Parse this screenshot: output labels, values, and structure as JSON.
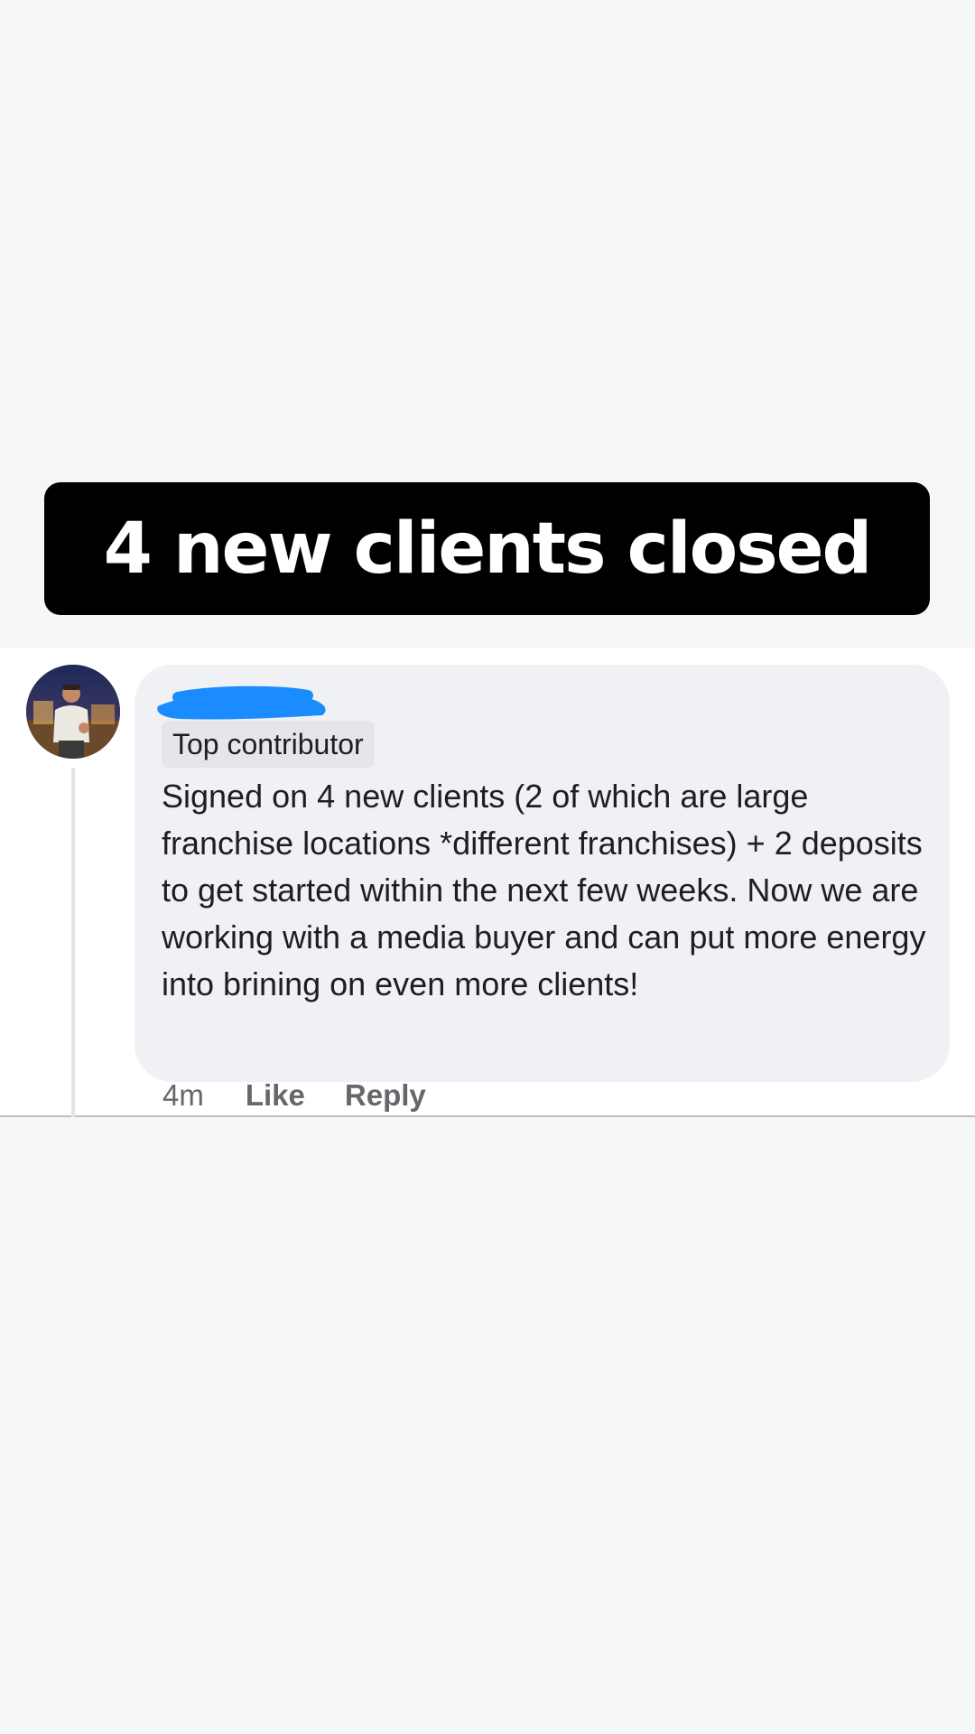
{
  "headline": {
    "text": "4 new clients closed"
  },
  "comment": {
    "badge": "Top contributor",
    "body": "Signed on 4 new clients (2 of which are large franchise locations *different franchises) + 2 deposits to get started within the next few weeks. Now we are working with a media buyer and can put more energy into brining on even more clients!",
    "time": "4m",
    "like_label": "Like",
    "reply_label": "Reply"
  },
  "colors": {
    "page_background": "#f5f6f8",
    "headline_background": "#000000",
    "headline_text": "#ffffff",
    "bubble_background": "#f0f1f4",
    "badge_background": "#e4e6eb",
    "redaction": "#1a8cff",
    "meta_text": "#65676b"
  },
  "icons": {
    "avatar": "profile-photo",
    "redaction": "blue-scribble-redaction"
  }
}
